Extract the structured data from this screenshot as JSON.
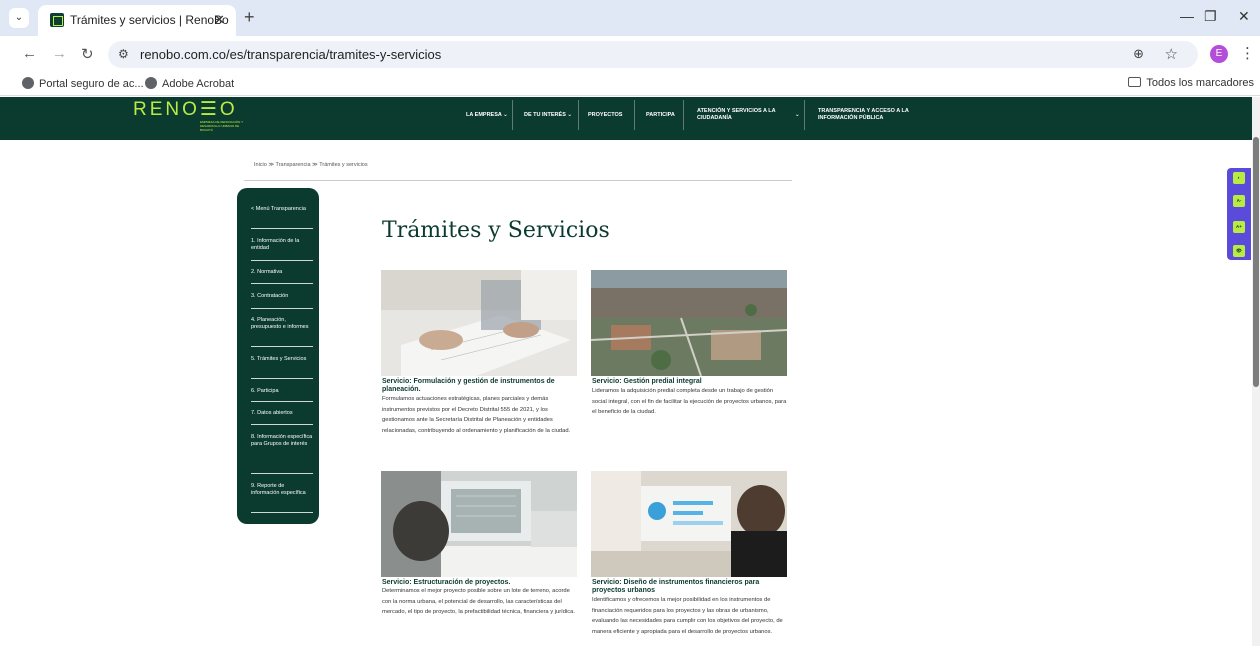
{
  "browser": {
    "tab_title": "Trámites y servicios | RenoBo",
    "tab_close": "✕",
    "new_tab": "+",
    "tab_list": "⌄",
    "url": "renobo.com.co/es/transparencia/tramites-y-servicios",
    "profile_initial": "E",
    "bookmarks": [
      "Portal seguro de ac...",
      "Adobe Acrobat"
    ],
    "all_bookmarks": "Todos los marcadores"
  },
  "site": {
    "logo": "RENO☰O",
    "logo_sub": "EMPRESA DE RENOVACIÓN Y DESARROLLO URBANO DE BOGOTÁ",
    "nav": [
      "LA EMPRESA ⌄",
      "DE TU INTERÉS ⌄",
      "PROYECTOS",
      "PARTICIPA",
      "ATENCIÓN Y SERVICIOS A LA CIUDADANÍA",
      "TRANSPARENCIA Y ACCESO A LA INFORMACIÓN PÚBLICA"
    ],
    "nav_chevron": "⌄"
  },
  "breadcrumb": "Inicio  ≫  Transparencia  ≫  Trámites y servicios",
  "side_menu": [
    "< Menú Transparencia",
    "1. Información de la entidad",
    "2. Normativa",
    "3. Contratación",
    "4. Planeación, presupuesto e informes",
    "5. Trámites y Servicios",
    "6. Participa",
    "7. Datos abiertos",
    "8. Información específica para Grupos de interés",
    "9. Reporte de información específica"
  ],
  "page_title": "Trámites y Servicios",
  "cards": [
    {
      "title": "Servicio: Formulación y gestión de instrumentos de planeación.",
      "desc": "Formulamos actuaciones estratégicas, planes parciales y demás instrumentos previstos por el Decreto Distrital 555 de 2021, y los gestionamos ante la Secretaría Distrital de Planeación y entidades relacionadas, contribuyendo al ordenamiento y planificación de la ciudad."
    },
    {
      "title": "Servicio: Gestión predial integral",
      "desc": "Lideramos la adquisición predial completa desde un trabajo de gestión social integral, con el fin de facilitar la ejecución de proyectos urbanos, para el beneficio de la ciudad."
    },
    {
      "title": "Servicio: Estructuración de proyectos.",
      "desc": "Determinamos el mejor proyecto posible sobre un lote de terreno, acorde con la norma urbana, el potencial de desarrollo, las características del mercado, el tipo de proyecto, la prefactibilidad técnica, financiera y jurídica."
    },
    {
      "title": "Servicio: Diseño de instrumentos financieros para proyectos urbanos",
      "desc": "Identificamos y ofrecemos la mejor posibilidad en los instrumentos de financiación requeridos para los proyectos y las obras de urbanismo, evaluando las necesidades para cumplir con los objetivos del proyecto, de manera eficiente y apropiada para el desarrollo de proyectos urbanos."
    }
  ],
  "a11y_buttons": [
    "◐",
    "A-",
    "A+",
    "👁"
  ],
  "colors": {
    "brand_dark": "#0b3a2f",
    "brand_lime": "#b9ec43",
    "a11y": "#5b4bdb"
  }
}
